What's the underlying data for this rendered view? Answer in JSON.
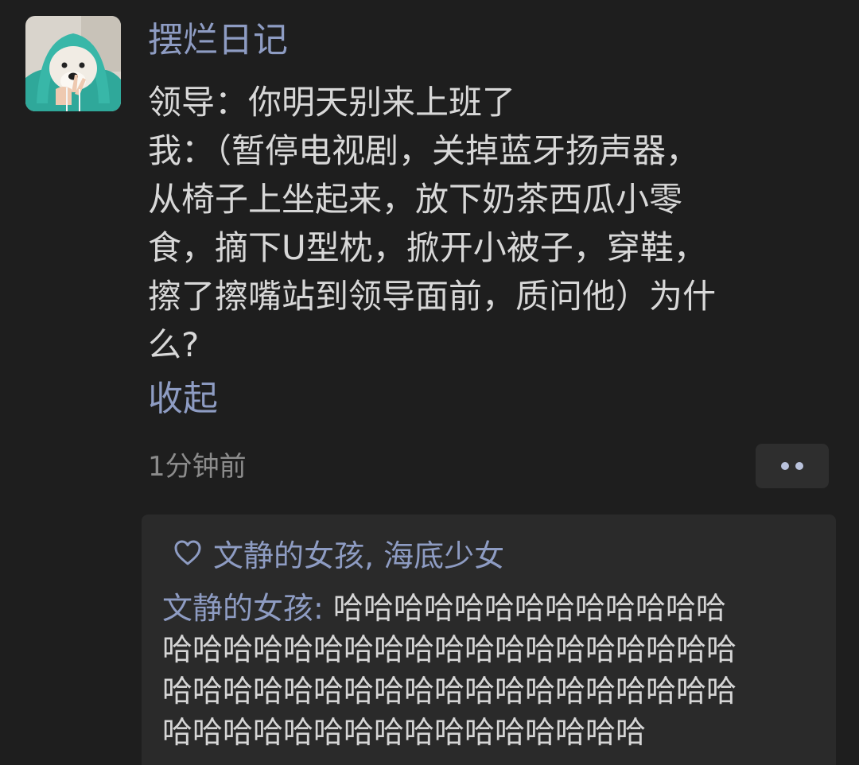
{
  "post": {
    "username": "摆烂日记",
    "body_lines": [
      "领导：你明天别来上班了",
      "我：（暂停电视剧，关掉蓝牙扬声器，",
      "从椅子上坐起来，放下奶茶西瓜小零",
      "食，摘下U型枕，掀开小被子，穿鞋，",
      "擦了擦嘴站到领导面前，质问他）为什",
      "么?"
    ],
    "collapse_label": "收起",
    "timestamp": "1分钟前"
  },
  "interactions": {
    "likes": "文静的女孩, 海底少女",
    "comment": {
      "author": "文静的女孩",
      "separator": ": ",
      "text_first_line": "哈哈哈哈哈哈哈哈哈哈哈哈哈",
      "text_lines": [
        "哈哈哈哈哈哈哈哈哈哈哈哈哈哈哈哈哈哈哈",
        "哈哈哈哈哈哈哈哈哈哈哈哈哈哈哈哈哈哈哈",
        "哈哈哈哈哈哈哈哈哈哈哈哈哈哈哈哈"
      ]
    }
  },
  "icons": {
    "like": "heart-icon",
    "more": "more-dots-icon"
  },
  "colors": {
    "background": "#1e1e1e",
    "name_accent": "#8e9cc3",
    "body_text": "#d8d8d8",
    "muted_text": "#8c8c8c",
    "comment_bg": "#2a2a2a"
  }
}
